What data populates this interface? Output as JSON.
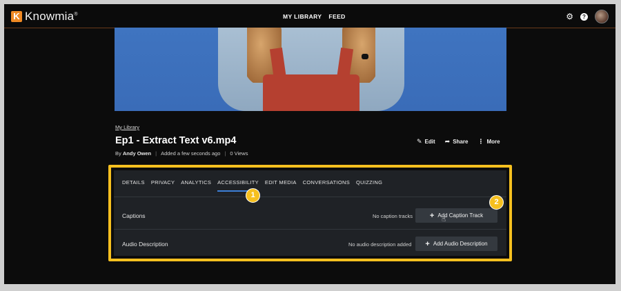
{
  "app": {
    "logo_letter": "K",
    "name": "Knowmia",
    "trademark": "®"
  },
  "nav": [
    {
      "label": "MY LIBRARY"
    },
    {
      "label": "FEED"
    }
  ],
  "top_icons": {
    "help_glyph": "?"
  },
  "breadcrumb": "My Library",
  "media": {
    "title": "Ep1 - Extract Text v6.mp4",
    "author_prefix": "By",
    "author": "Andy Owen",
    "added": "Added a few seconds ago",
    "views": "0 Views"
  },
  "actions": [
    {
      "label": "Edit",
      "icon": "pencil-icon"
    },
    {
      "label": "Share",
      "icon": "share-icon"
    },
    {
      "label": "More",
      "icon": "more-icon"
    }
  ],
  "tabs": [
    {
      "label": "DETAILS"
    },
    {
      "label": "PRIVACY"
    },
    {
      "label": "ANALYTICS"
    },
    {
      "label": "ACCESSIBILITY",
      "active": true
    },
    {
      "label": "EDIT MEDIA"
    },
    {
      "label": "CONVERSATIONS"
    },
    {
      "label": "QUIZZING"
    }
  ],
  "accessibility": {
    "captions": {
      "label": "Captions",
      "status": "No caption tracks",
      "button": "Add Caption Track"
    },
    "audio_description": {
      "label": "Audio Description",
      "status": "No audio description added",
      "button": "Add Audio Description"
    }
  },
  "callouts": [
    "1",
    "2"
  ],
  "colors": {
    "accent": "#3d80d8",
    "highlight": "#f6c01f",
    "brand": "#f08a24"
  }
}
